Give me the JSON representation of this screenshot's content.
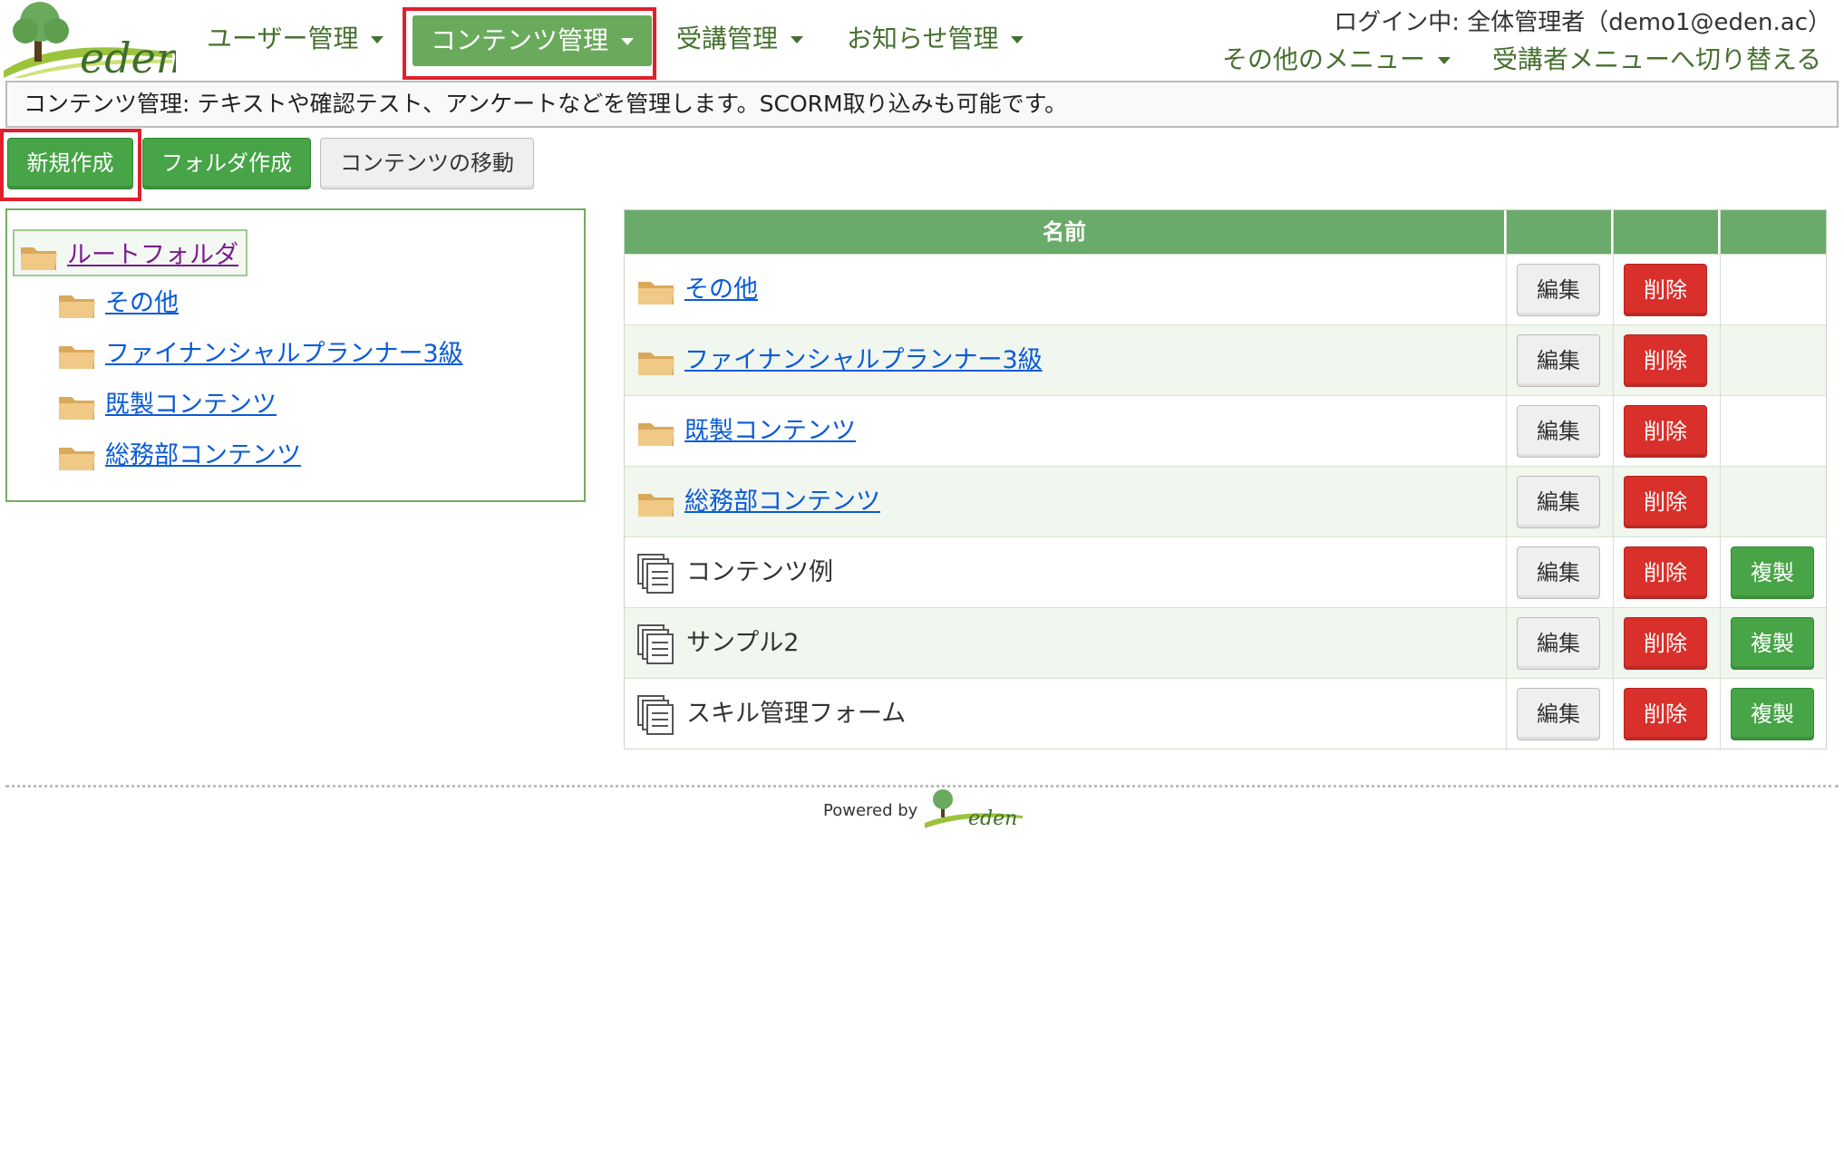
{
  "header": {
    "logo_text": "eden",
    "nav": [
      {
        "label": "ユーザー管理"
      },
      {
        "label": "コンテンツ管理"
      },
      {
        "label": "受講管理"
      },
      {
        "label": "お知らせ管理"
      }
    ],
    "login_text": "ログイン中: 全体管理者（demo1@eden.ac）",
    "other_menu": "その他のメニュー",
    "switch_menu": "受講者メニューへ切り替える"
  },
  "description": "コンテンツ管理: テキストや確認テスト、アンケートなどを管理します。SCORM取り込みも可能です。",
  "toolbar": {
    "new_label": "新規作成",
    "folder_label": "フォルダ作成",
    "move_label": "コンテンツの移動"
  },
  "tree": {
    "root": "ルートフォルダ",
    "children": [
      "その他",
      "ファイナンシャルプランナー3級",
      "既製コンテンツ",
      "総務部コンテンツ"
    ]
  },
  "table": {
    "header_name": "名前",
    "edit_label": "編集",
    "delete_label": "削除",
    "copy_label": "複製",
    "rows": [
      {
        "name": "その他",
        "type": "folder"
      },
      {
        "name": "ファイナンシャルプランナー3級",
        "type": "folder"
      },
      {
        "name": "既製コンテンツ",
        "type": "folder"
      },
      {
        "name": "総務部コンテンツ",
        "type": "folder"
      },
      {
        "name": "コンテンツ例",
        "type": "content"
      },
      {
        "name": "サンプル2",
        "type": "content"
      },
      {
        "name": "スキル管理フォーム",
        "type": "content"
      }
    ]
  },
  "footer": {
    "powered_by": "Powered by",
    "logo_text": "eden"
  },
  "colors": {
    "accent_green": "#6aaa5c",
    "button_green": "#47a447",
    "button_red": "#d9302b",
    "highlight_red": "#e0202c",
    "nav_text": "#46702f"
  }
}
